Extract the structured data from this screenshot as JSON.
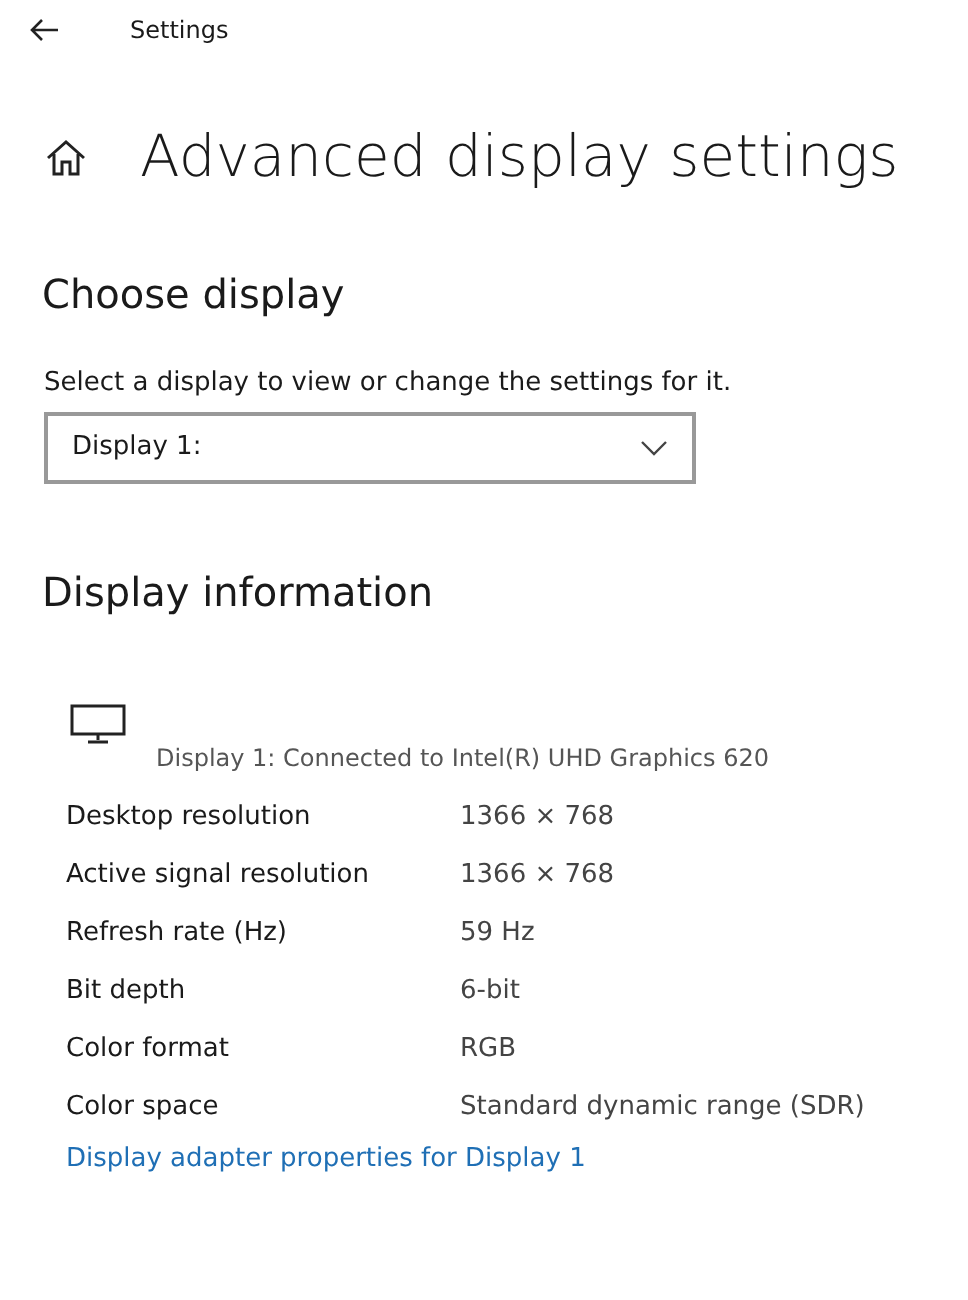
{
  "window": {
    "title": "Settings"
  },
  "page": {
    "title": "Advanced display settings"
  },
  "choose_display": {
    "heading": "Choose display",
    "description": "Select a display to view or change the settings for it.",
    "dropdown": {
      "value": "Display 1:"
    }
  },
  "display_information": {
    "heading": "Display information",
    "connection": "Display 1: Connected to Intel(R) UHD Graphics 620",
    "rows": [
      {
        "label": "Desktop resolution",
        "value": "1366 × 768"
      },
      {
        "label": "Active signal resolution",
        "value": "1366 × 768"
      },
      {
        "label": "Refresh rate (Hz)",
        "value": "59 Hz"
      },
      {
        "label": "Bit depth",
        "value": "6-bit"
      },
      {
        "label": "Color format",
        "value": "RGB"
      },
      {
        "label": "Color space",
        "value": "Standard dynamic range (SDR)"
      }
    ],
    "link": "Display adapter properties for Display 1"
  }
}
